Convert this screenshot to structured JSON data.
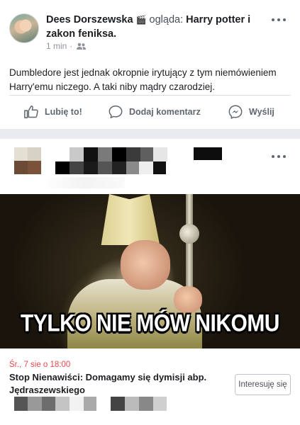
{
  "post1": {
    "author": "Dees Dorszewska",
    "activity_icon": "clapperboard-emoji",
    "verb": "ogląda:",
    "subject": "Harry potter i zakon feniksa.",
    "time": "1 min",
    "audience_icon": "friends-icon",
    "text": "Dumbledore jest jednak okropnie irytujący z tym niemówieniem Harry'emu niczego. A taki niby mądry czarodziej.",
    "actions": {
      "like": "Lubię to!",
      "comment": "Dodaj komentarz",
      "share": "Wyślij"
    }
  },
  "post2": {
    "meme_caption": "TYLKO NIE MÓW NIKOMU",
    "event": {
      "date": "Śr., 7 sie o 18:00",
      "title": "Stop Nienawiści: Domagamy się dymisji abp. Jędraszewskiego",
      "button": "Interesuję się"
    }
  },
  "colors": {
    "event_date": "#e9484a",
    "action_text": "#606770",
    "background": "#e9ebee"
  }
}
